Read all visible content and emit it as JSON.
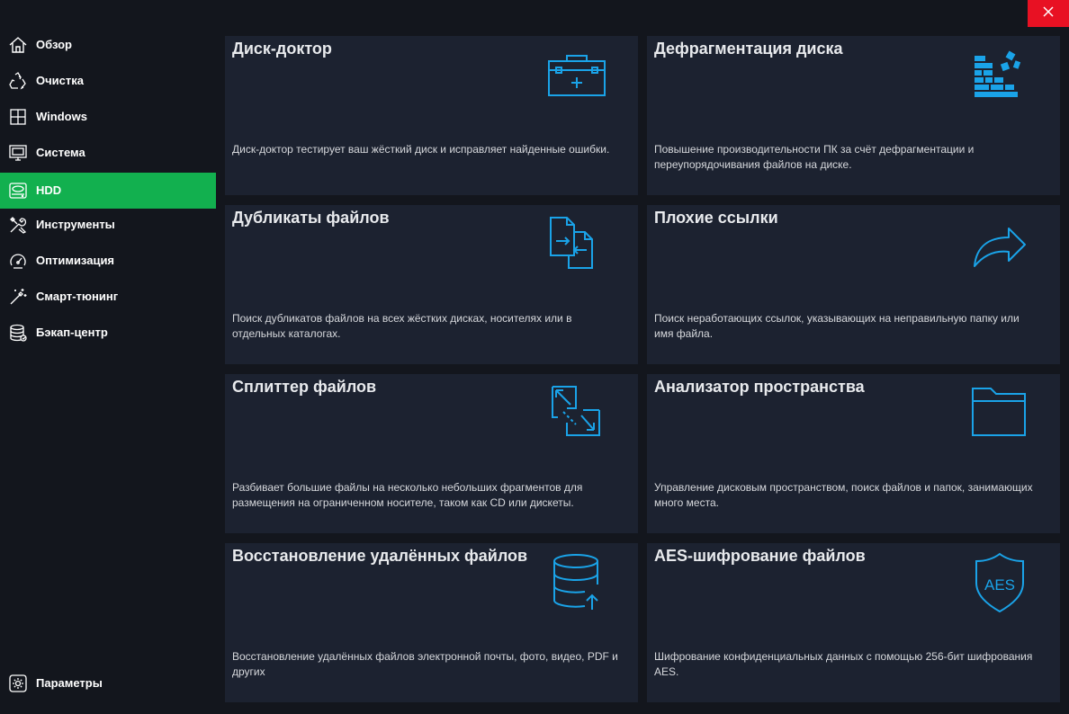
{
  "window": {
    "close_icon": "close-icon",
    "colors": {
      "accent": "#12b04f",
      "icon": "#1aa3e8",
      "close": "#e81123",
      "card_bg": "#1c2230",
      "app_bg": "#13161d"
    }
  },
  "sidebar": {
    "items": [
      {
        "label": "Обзор",
        "icon": "home-icon"
      },
      {
        "label": "Очистка",
        "icon": "recycle-icon"
      },
      {
        "label": "Windows",
        "icon": "windows-icon"
      },
      {
        "label": "Система",
        "icon": "monitor-icon"
      },
      {
        "label": "HDD",
        "icon": "hdd-icon",
        "active": true
      },
      {
        "label": "Инструменты",
        "icon": "tools-icon"
      },
      {
        "label": "Оптимизация",
        "icon": "gauge-icon"
      },
      {
        "label": "Смарт-тюнинг",
        "icon": "magic-wand-icon"
      },
      {
        "label": "Бэкап-центр",
        "icon": "database-icon"
      }
    ],
    "settings": {
      "label": "Параметры",
      "icon": "gear-icon"
    }
  },
  "cards": [
    {
      "title": "Диск-доктор",
      "desc": "Диск-доктор тестирует ваш жёсткий диск и исправляет найденные ошибки.",
      "icon": "medical-kit-icon"
    },
    {
      "title": "Дефрагментация диска",
      "desc": "Повышение производительности ПК за счёт дефрагментации и переупорядочивания файлов на диске.",
      "icon": "defrag-blocks-icon"
    },
    {
      "title": "Дубликаты файлов",
      "desc": "Поиск дубликатов файлов на всех жёстких дисках, носителях или в отдельных каталогах.",
      "icon": "duplicate-files-icon"
    },
    {
      "title": "Плохие ссылки",
      "desc": "Поиск неработающих ссылок, указывающих на неправильную папку или имя файла.",
      "icon": "share-arrow-icon"
    },
    {
      "title": "Сплиттер файлов",
      "desc": "Разбивает большие файлы на несколько небольших фрагментов для размещения на ограниченном носителе, таком как CD или дискеты.",
      "icon": "split-file-icon"
    },
    {
      "title": "Анализатор пространства",
      "desc": "Управление дисковым пространством, поиск файлов и папок, занимающих много места.",
      "icon": "folder-icon"
    },
    {
      "title": "Восстановление удалённых файлов",
      "desc": "Восстановление удалённых файлов электронной почты, фото, видео, PDF и других",
      "icon": "database-restore-icon"
    },
    {
      "title": "AES-шифрование файлов",
      "desc": "Шифрование конфиденциальных данных с помощью 256-бит шифрования AES.",
      "icon": "aes-shield-icon",
      "icon_text": "AES"
    }
  ]
}
